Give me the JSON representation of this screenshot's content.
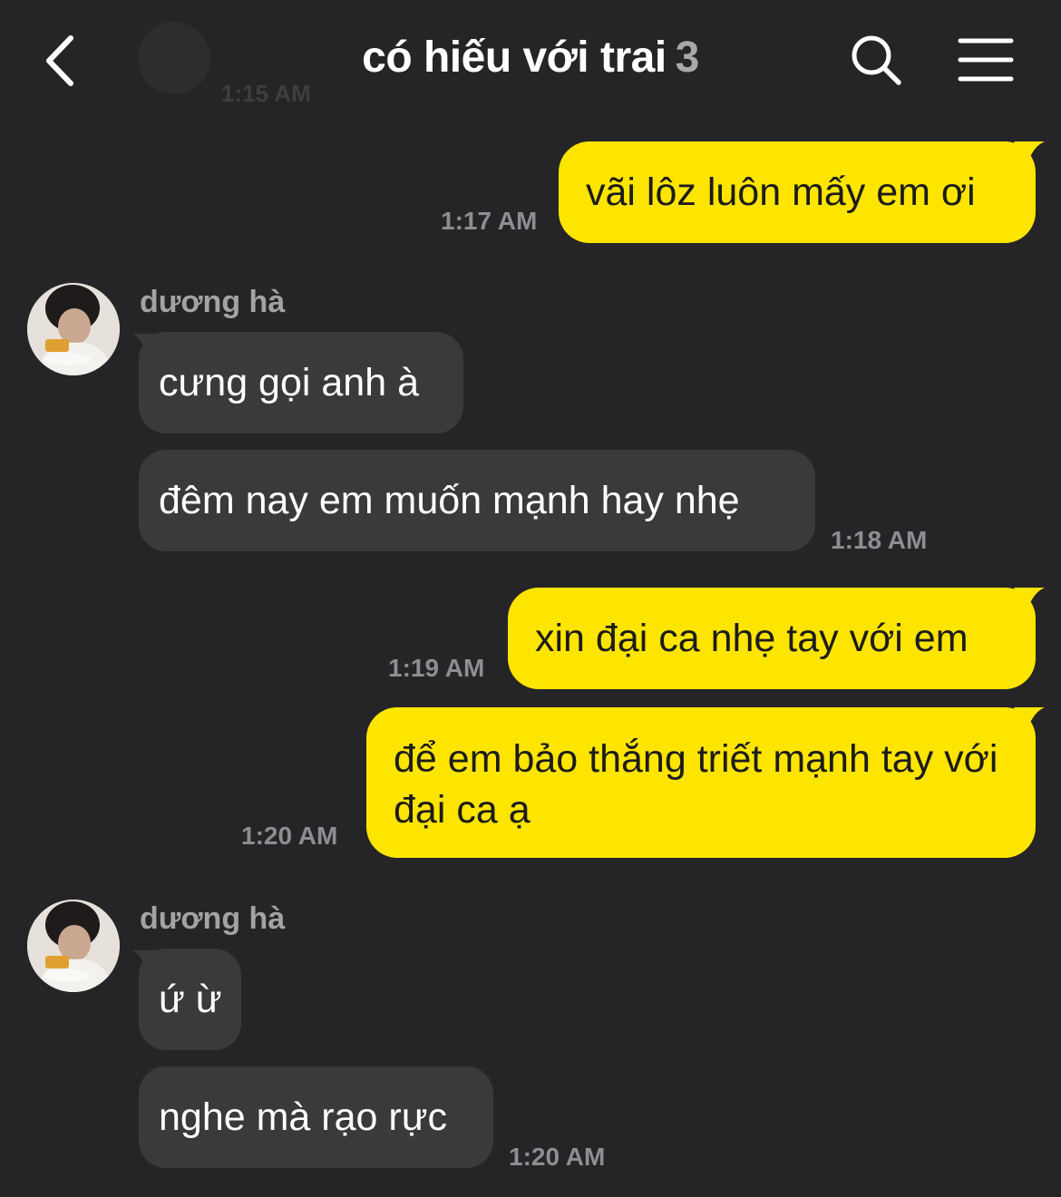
{
  "header": {
    "title": "có hiếu với trai",
    "count": "3",
    "ghost_time": "1:15 AM"
  },
  "messages": [
    {
      "type": "out",
      "text": "vãi lôz luôn mấy em ơi",
      "time": "1:17 AM"
    },
    {
      "type": "in_group",
      "sender": "dương hà",
      "bubbles": [
        "cưng gọi anh à",
        "đêm nay em muốn mạnh hay nhẹ"
      ],
      "time": "1:18 AM"
    },
    {
      "type": "out",
      "text": "xin đại ca nhẹ tay với em",
      "time": "1:19 AM"
    },
    {
      "type": "out",
      "text": "để em bảo thắng triết mạnh tay với đại ca ạ",
      "time": "1:20 AM"
    },
    {
      "type": "in_group",
      "sender": "dương hà",
      "bubbles": [
        "ứ ừ",
        "nghe mà rạo rực"
      ],
      "time": "1:20 AM"
    }
  ],
  "colors": {
    "background": "#252527",
    "outgoing_bubble": "#fee500",
    "incoming_bubble": "#3a3a3c",
    "timestamp": "#8e8e92"
  },
  "icons": [
    "back-arrow-icon",
    "search-icon",
    "menu-icon"
  ]
}
